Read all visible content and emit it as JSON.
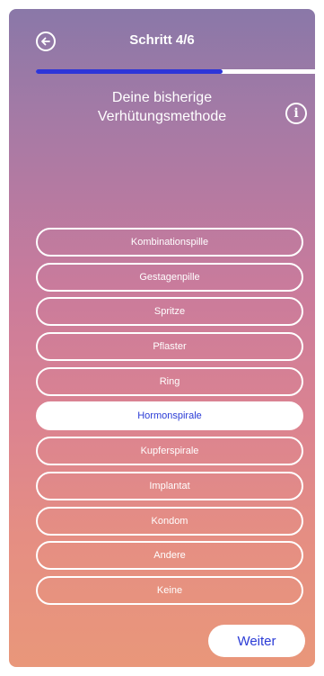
{
  "header": {
    "back_icon": "arrow-left-circle-icon",
    "title": "Schritt 4/6",
    "progress": 0.67
  },
  "question": {
    "line1": "Deine bisherige",
    "line2": "Verhütungsmethode",
    "info_icon": "info-icon",
    "info_glyph": "i"
  },
  "options": [
    {
      "label": "Kombinationspille",
      "selected": false
    },
    {
      "label": "Gestagenpille",
      "selected": false
    },
    {
      "label": "Spritze",
      "selected": false
    },
    {
      "label": "Pflaster",
      "selected": false
    },
    {
      "label": "Ring",
      "selected": false
    },
    {
      "label": "Hormonspirale",
      "selected": true
    },
    {
      "label": "Kupferspirale",
      "selected": false
    },
    {
      "label": "Implantat",
      "selected": false
    },
    {
      "label": "Kondom",
      "selected": false
    },
    {
      "label": "Andere",
      "selected": false
    },
    {
      "label": "Keine",
      "selected": false
    }
  ],
  "footer": {
    "next_label": "Weiter"
  },
  "colors": {
    "accent": "#2a3bd6",
    "progress_fill": "#2d35d8",
    "gradient_top": "#8a78a8",
    "gradient_bottom": "#e9977a"
  }
}
